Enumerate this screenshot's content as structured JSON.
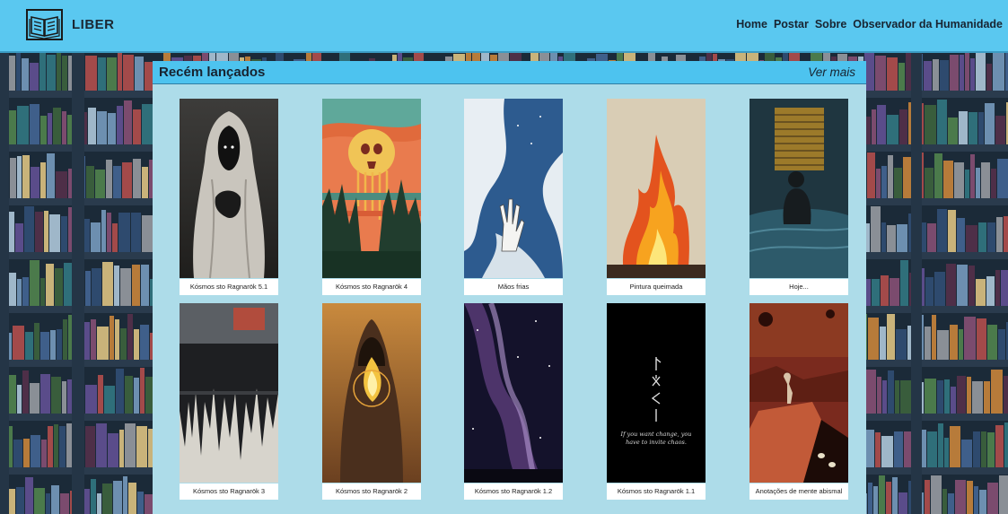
{
  "header": {
    "brand": "LIBER",
    "nav": [
      "Home",
      "Postar",
      "Sobre",
      "Observador da Humanidade"
    ]
  },
  "section": {
    "title": "Recém lançados",
    "more_label": "Ver mais"
  },
  "cards": [
    {
      "title": "Kósmos sto Ragnarök 5.1",
      "art": "hooded-figure"
    },
    {
      "title": "Kósmos sto Ragnarök 4",
      "art": "skull-sunset"
    },
    {
      "title": "Mãos frias",
      "art": "hand-in-sky"
    },
    {
      "title": "Pintura queimada",
      "art": "burning-painting"
    },
    {
      "title": "Hoje...",
      "art": "seated-figure-by-window"
    },
    {
      "title": "Kósmos sto Ragnarök 3",
      "art": "dripping-crowd"
    },
    {
      "title": "Kósmos sto Ragnarök 2",
      "art": "hooded-figure-flame"
    },
    {
      "title": "Kósmos sto Ragnarök 1.2",
      "art": "milky-way"
    },
    {
      "title": "Kósmos sto Ragnarök 1.1",
      "art": "runes-quote",
      "quote": "If you want change, you have to invite chaos."
    },
    {
      "title": "Anotações de mente abismal",
      "art": "figure-on-cliff"
    }
  ],
  "colors": {
    "header": "#5ac8f0",
    "panel": "#addce9",
    "panel_header": "#4dc3ef"
  }
}
